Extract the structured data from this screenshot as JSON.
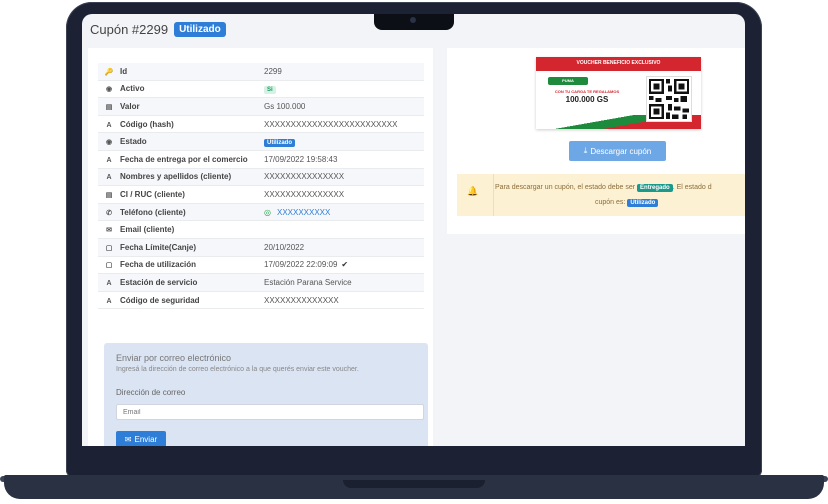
{
  "header": {
    "title": "Cupón #2299",
    "status": "Utilizado"
  },
  "details": [
    {
      "icon": "key-icon",
      "glyph": "🔑",
      "label": "Id",
      "value": "2299"
    },
    {
      "icon": "toggle-icon",
      "glyph": "◉",
      "label": "Activo",
      "value": "Si",
      "badge": "si"
    },
    {
      "icon": "money-icon",
      "glyph": "▤",
      "label": "Valor",
      "value": "Gs 100.000"
    },
    {
      "icon": "text-icon",
      "glyph": "A",
      "label": "Código (hash)",
      "value": "XXXXXXXXXXXXXXXXXXXXXXXXX"
    },
    {
      "icon": "toggle-icon",
      "glyph": "◉",
      "label": "Estado",
      "value": "Utilizado",
      "badge": "blue"
    },
    {
      "icon": "text-icon",
      "glyph": "A",
      "label": "Fecha de entrega por el comercio",
      "value": "17/09/2022 19:58:43"
    },
    {
      "icon": "text-icon",
      "glyph": "A",
      "label": "Nombres y apellidos (cliente)",
      "value": "XXXXXXXXXXXXXXX"
    },
    {
      "icon": "id-card-icon",
      "glyph": "▤",
      "label": "CI / RUC (cliente)",
      "value": "XXXXXXXXXXXXXXX"
    },
    {
      "icon": "phone-icon",
      "glyph": "✆",
      "label": "Teléfono (cliente)",
      "value": "XXXXXXXXXX",
      "whatsapp": true
    },
    {
      "icon": "envelope-icon",
      "glyph": "✉",
      "label": "Email (cliente)",
      "value": ""
    },
    {
      "icon": "calendar-icon",
      "glyph": "▢",
      "label": "Fecha Límite(Canje)",
      "value": "20/10/2022"
    },
    {
      "icon": "calendar-icon",
      "glyph": "▢",
      "label": "Fecha de utilización",
      "value": "17/09/2022 22:09:09",
      "check": true
    },
    {
      "icon": "text-icon",
      "glyph": "A",
      "label": "Estación de servicio",
      "value": "Estación Parana Service"
    },
    {
      "icon": "text-icon",
      "glyph": "A",
      "label": "Código de seguridad",
      "value": "XXXXXXXXXXXXXX"
    }
  ],
  "email_form": {
    "title": "Enviar por correo electrónico",
    "description": "Ingresá la dirección de correo electrónico a la que querés enviar este voucher.",
    "label": "Dirección de correo",
    "placeholder": "Email",
    "send_label": "Enviar"
  },
  "voucher": {
    "header": "VOUCHER BENEFICIO EXCLUSIVO",
    "logo": "PUMA",
    "subtitle": "CON TU CARGA TE REGALAMOS",
    "amount": "100.000 GS"
  },
  "download_label": "Descargar cupón",
  "alert": {
    "prefix": "Para descargar un cupón, el estado debe ser",
    "badge1": "Entregado",
    "middle": ". El estado d",
    "line2_prefix": "cupón es:",
    "badge2": "Utilizado"
  },
  "colors": {
    "primary": "#2e7ed8",
    "alert_bg": "#fdf1d3",
    "voucher_red": "#d4262e",
    "voucher_green": "#1d8a3c"
  }
}
